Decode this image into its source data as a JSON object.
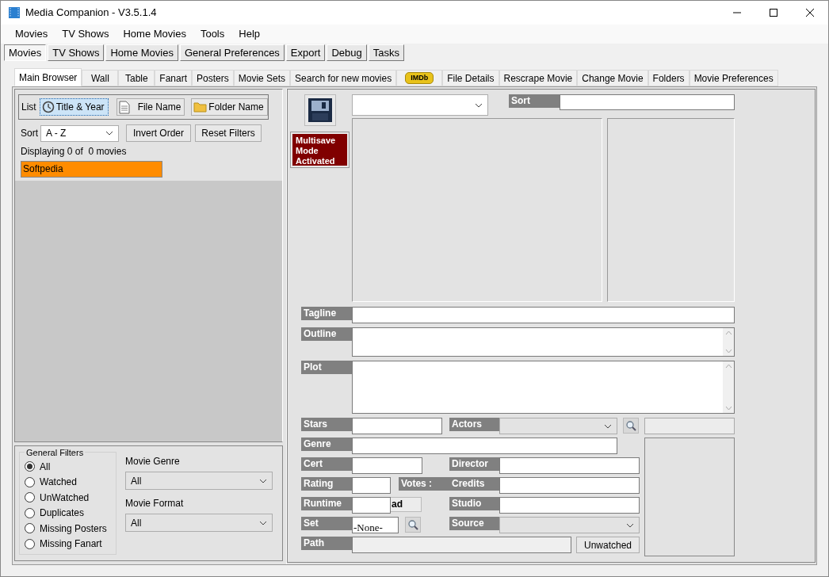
{
  "window": {
    "title": "Media Companion - V3.5.1.4"
  },
  "menu": [
    "Movies",
    "TV Shows",
    "Home Movies",
    "Tools",
    "Help"
  ],
  "top_tabs": [
    {
      "label": "Movies",
      "selected": true
    },
    {
      "label": "TV Shows",
      "selected": false
    },
    {
      "label": "Home Movies",
      "selected": false
    },
    {
      "label": "General Preferences",
      "selected": false
    },
    {
      "label": "Export",
      "selected": false
    },
    {
      "label": "Debug",
      "selected": false
    },
    {
      "label": "Tasks",
      "selected": false
    }
  ],
  "browser_tabs": [
    {
      "label": "Main Browser",
      "selected": true,
      "kind": "text"
    },
    {
      "label": "Wall",
      "selected": false,
      "kind": "text"
    },
    {
      "label": "Table",
      "selected": false,
      "kind": "text"
    },
    {
      "label": "Fanart",
      "selected": false,
      "kind": "text"
    },
    {
      "label": "Posters",
      "selected": false,
      "kind": "text"
    },
    {
      "label": "Movie Sets",
      "selected": false,
      "kind": "text"
    },
    {
      "label": "Search for new movies",
      "selected": false,
      "kind": "text"
    },
    {
      "label": "IMDb",
      "selected": false,
      "kind": "logo"
    },
    {
      "label": "File Details",
      "selected": false,
      "kind": "text"
    },
    {
      "label": "Rescrape Movie",
      "selected": false,
      "kind": "text"
    },
    {
      "label": "Change Movie",
      "selected": false,
      "kind": "text"
    },
    {
      "label": "Folders",
      "selected": false,
      "kind": "text"
    },
    {
      "label": "Movie Preferences",
      "selected": false,
      "kind": "text"
    }
  ],
  "browser": {
    "list_label": "List",
    "list_modes": [
      {
        "label": "Title & Year",
        "selected": true,
        "kind": "clock"
      },
      {
        "label": "File Name",
        "selected": false,
        "kind": "file"
      },
      {
        "label": "Folder Name",
        "selected": false,
        "kind": "folder"
      }
    ],
    "sort": {
      "label": "Sort",
      "value": "A - Z"
    },
    "buttons": [
      "Invert Order",
      "Reset Filters"
    ],
    "displaying": "Displaying 0 of  0 movies",
    "movies": [
      {
        "title": "Softpedia",
        "selected": true
      }
    ],
    "filters": {
      "title": "General Filters",
      "options": [
        {
          "label": "All",
          "selected": true
        },
        {
          "label": "Watched",
          "selected": false
        },
        {
          "label": "UnWatched",
          "selected": false
        },
        {
          "label": "Duplicates",
          "selected": false
        },
        {
          "label": "Missing Posters",
          "selected": false
        },
        {
          "label": "Missing Fanart",
          "selected": false
        }
      ]
    },
    "movie_genre": {
      "label": "Movie Genre",
      "value": "All"
    },
    "movie_format": {
      "label": "Movie Format",
      "value": "All"
    }
  },
  "details": {
    "multisave": "Multisave Mode Activated",
    "sort_label": "Sort",
    "tagline": "Tagline",
    "outline": "Outline",
    "plot": "Plot",
    "stars": "Stars",
    "actors": "Actors",
    "genre": "Genre",
    "cert": "Cert",
    "director": "Director",
    "rating": "Rating",
    "votes": "Votes :",
    "credits": "Credits",
    "runtime": "Runtime",
    "runtime_button": "ad",
    "studio": "Studio",
    "set": "Set",
    "set_value": "-None-",
    "source": "Source",
    "path": "Path",
    "watched_button": "Unwatched"
  }
}
